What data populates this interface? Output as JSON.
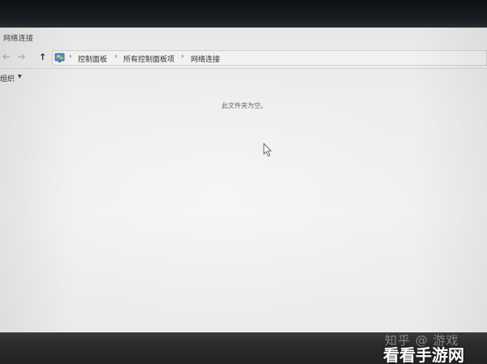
{
  "window": {
    "title": "网络连接"
  },
  "navigation": {
    "back_icon": "arrow-left-icon",
    "forward_icon": "arrow-right-icon",
    "up_symbol": "↑",
    "address_icon": "control-panel-icon",
    "separator": "›",
    "breadcrumbs": [
      "控制面板",
      "所有控制面板项",
      "网络连接"
    ]
  },
  "toolbar": {
    "organize_label": "组织",
    "organize_caret": "▼"
  },
  "content": {
    "empty_message": "此文件夹为空。"
  },
  "watermark": {
    "faint_text": "知乎 @ 游戏",
    "text": "看看手游网"
  }
}
